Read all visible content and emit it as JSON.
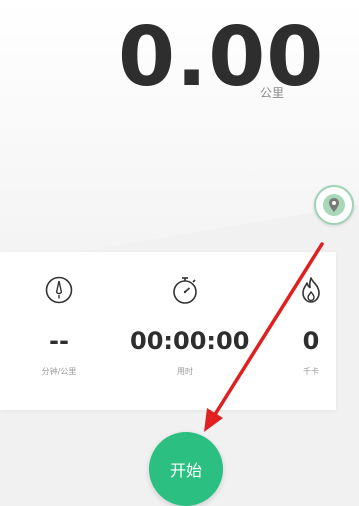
{
  "distance": {
    "value": "0.00",
    "unit": "公里"
  },
  "stats": [
    {
      "icon": "speedometer-icon",
      "value": "--",
      "label": "分钟/公里"
    },
    {
      "icon": "stopwatch-icon",
      "value": "00:00:00",
      "label": "用时"
    },
    {
      "icon": "flame-icon",
      "value": "0",
      "label": "千卡"
    }
  ],
  "start_button": {
    "label": "开始"
  },
  "colors": {
    "accent": "#2bbf81",
    "annotation": "#e02020"
  }
}
